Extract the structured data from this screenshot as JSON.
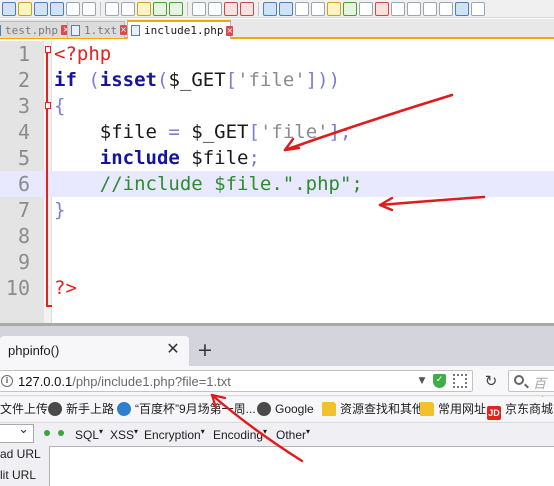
{
  "editor": {
    "tabs": [
      {
        "label": "test.php",
        "active": false
      },
      {
        "label": "1.txt",
        "active": false
      },
      {
        "label": "include1.php",
        "active": true
      }
    ],
    "lines": [
      {
        "n": "1",
        "tokens": [
          {
            "t": "<?php",
            "c": "tag"
          }
        ]
      },
      {
        "n": "2",
        "tokens": [
          {
            "t": "if",
            "c": "kw"
          },
          {
            "t": " (",
            "c": "op"
          },
          {
            "t": "isset",
            "c": "kw"
          },
          {
            "t": "(",
            "c": "op"
          },
          {
            "t": "$_GET",
            "c": "txt"
          },
          {
            "t": "[",
            "c": "op"
          },
          {
            "t": "'file'",
            "c": "str"
          },
          {
            "t": "]))",
            "c": "op"
          }
        ]
      },
      {
        "n": "3",
        "tokens": [
          {
            "t": "{",
            "c": "op"
          }
        ]
      },
      {
        "n": "4",
        "tokens": [
          {
            "t": "    $file ",
            "c": "txt"
          },
          {
            "t": "=",
            "c": "op"
          },
          {
            "t": " $_GET",
            "c": "txt"
          },
          {
            "t": "[",
            "c": "op"
          },
          {
            "t": "'file'",
            "c": "str"
          },
          {
            "t": "];",
            "c": "op"
          }
        ]
      },
      {
        "n": "5",
        "tokens": [
          {
            "t": "    ",
            "c": "txt"
          },
          {
            "t": "include",
            "c": "kw"
          },
          {
            "t": " $file",
            "c": "txt"
          },
          {
            "t": ";",
            "c": "op"
          }
        ]
      },
      {
        "n": "6",
        "tokens": [
          {
            "t": "    //include $file.\".php\";",
            "c": "cm"
          }
        ]
      },
      {
        "n": "7",
        "tokens": [
          {
            "t": "}",
            "c": "op"
          }
        ]
      },
      {
        "n": "8",
        "tokens": []
      },
      {
        "n": "9",
        "tokens": []
      },
      {
        "n": "10",
        "tokens": [
          {
            "t": "?>",
            "c": "tag"
          }
        ]
      }
    ],
    "highlighted_line": 6
  },
  "browser": {
    "tab_title": "phpinfo()",
    "new_tab": "+",
    "close_tab": "✕",
    "url_host": "127.0.0.1",
    "url_rest": "/php/include1.php?file=1.txt",
    "search_placeholder": "百度",
    "bookmarks": [
      {
        "label": "文件上传",
        "icon": "none"
      },
      {
        "label": "新手上路",
        "icon": "globe"
      },
      {
        "label": "“百度杯”9月场第一周...",
        "icon": "info"
      },
      {
        "label": "Google",
        "icon": "globe"
      },
      {
        "label": "资源查找和其他",
        "icon": "folder"
      },
      {
        "label": "常用网址",
        "icon": "folder"
      },
      {
        "label": "京东商城",
        "icon": "jd"
      }
    ],
    "hackbar_menus": [
      "SQL",
      "XSS",
      "Encryption",
      "Encoding",
      "Other"
    ],
    "hackbar_side": [
      "ad URL",
      "lit URL"
    ]
  },
  "colors": {
    "keyword": "#1414a0",
    "php_tag": "#e8211d",
    "comment": "#2e8b2e",
    "string": "#8c8c8c",
    "active_tab_accent": "#f5a700",
    "annotation_arrow": "#e01b1b"
  }
}
